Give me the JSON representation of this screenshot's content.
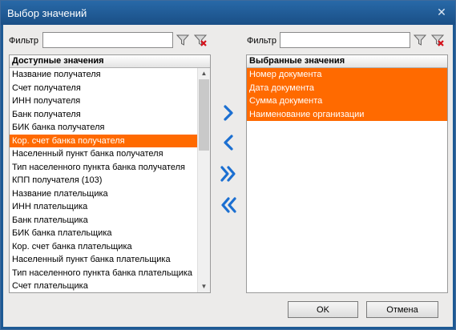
{
  "window": {
    "title": "Выбор значений",
    "close_glyph": "✕"
  },
  "left": {
    "filter_label": "Фильтр",
    "filter_value": "",
    "list_header": "Доступные значения",
    "items": [
      "Название получателя",
      "Счет получателя",
      "ИНН получателя",
      "Банк получателя",
      "БИК банка получателя",
      "Кор. счет банка получателя",
      "Населенный пункт банка получателя",
      "Тип населенного пункта банка получателя",
      "КПП получателя (103)",
      "Название плательщика",
      "ИНН плательщика",
      "Банк плательщика",
      "БИК банка плательщика",
      "Кор. счет банка плательщика",
      "Населенный пункт банка плательщика",
      "Тип населенного пункта банка плательщика",
      "Счет плательщика"
    ],
    "selected_index": 5
  },
  "right": {
    "filter_label": "Фильтр",
    "filter_value": "",
    "list_header": "Выбранные значения",
    "items": [
      "Номер документа",
      "Дата документа",
      "Сумма документа",
      "Наименование организации"
    ],
    "all_selected": true
  },
  "buttons": {
    "ok": "OK",
    "cancel": "Отмена"
  },
  "icons": {
    "filter": "filter-funnel-icon",
    "clear_filter": "clear-filter-icon",
    "move_right": "chevron-right-icon",
    "move_left": "chevron-left-icon",
    "move_all_right": "double-chevron-right-icon",
    "move_all_left": "double-chevron-left-icon"
  },
  "colors": {
    "selection": "#ff6a00",
    "arrow": "#1b6fd1",
    "titlebar": "#1e5a94"
  }
}
